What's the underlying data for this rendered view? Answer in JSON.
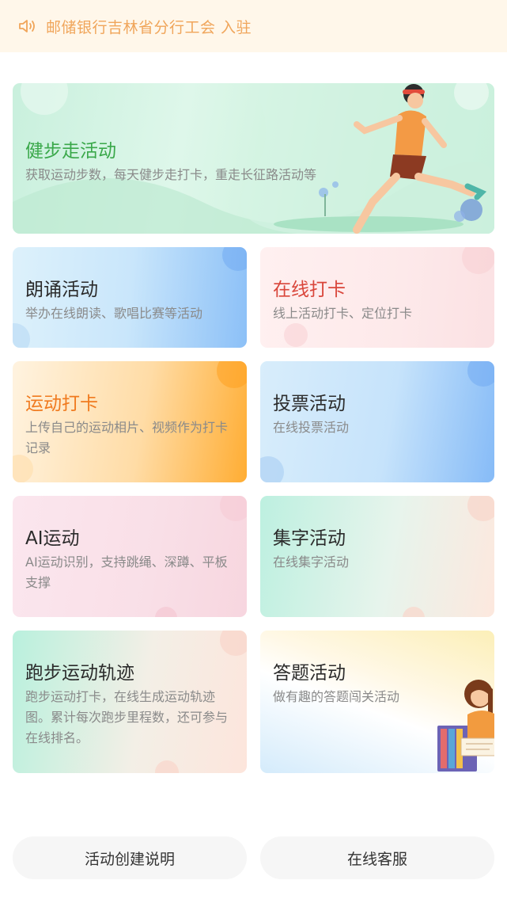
{
  "notice": {
    "icon": "speaker-icon",
    "text": "邮储银行吉林省分行工会 入驻",
    "color": "#f0a55a"
  },
  "activities": {
    "walk": {
      "title": "健步走活动",
      "desc": "获取运动步数，每天健步走打卡，重走长征路活动等"
    },
    "read": {
      "title": "朗诵活动",
      "desc": "举办在线朗读、歌唱比赛等活动"
    },
    "checkin": {
      "title": "在线打卡",
      "desc": "线上活动打卡、定位打卡"
    },
    "sport": {
      "title": "运动打卡",
      "desc": "上传自己的运动相片、视频作为打卡记录"
    },
    "vote": {
      "title": "投票活动",
      "desc": "在线投票活动"
    },
    "ai": {
      "title": "AI运动",
      "desc": "AI运动识别，支持跳绳、深蹲、平板支撑"
    },
    "word": {
      "title": "集字活动",
      "desc": "在线集字活动"
    },
    "run": {
      "title": "跑步运动轨迹",
      "desc": "跑步运动打卡，在线生成运动轨迹图。累计每次跑步里程数，还可参与在线排名。"
    },
    "quiz": {
      "title": "答题活动",
      "desc": "做有趣的答题闯关活动"
    }
  },
  "footer": {
    "help_label": "活动创建说明",
    "service_label": "在线客服"
  }
}
